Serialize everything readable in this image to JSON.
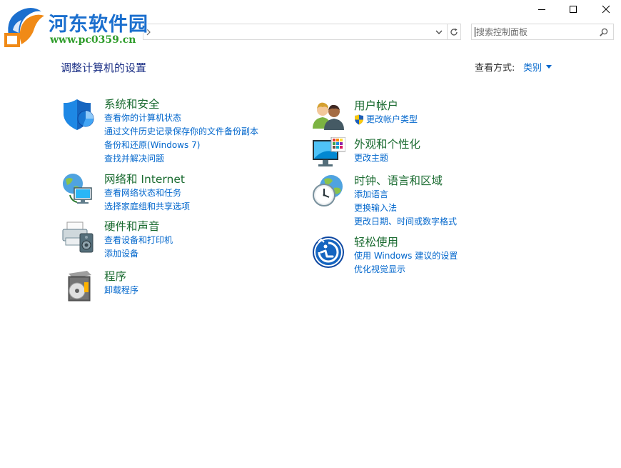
{
  "watermark": {
    "title": "河东软件园",
    "url": "www.pc0359.cn"
  },
  "address": {
    "path_text": ""
  },
  "search": {
    "placeholder": "搜索控制面板"
  },
  "header": {
    "title": "调整计算机的设置",
    "view_label": "查看方式:",
    "view_value": "类别"
  },
  "categories_left": [
    {
      "icon": "shield-security-icon",
      "title": "系统和安全",
      "links": [
        "查看你的计算机状态",
        "通过文件历史记录保存你的文件备份副本",
        "备份和还原(Windows 7)",
        "查找并解决问题"
      ]
    },
    {
      "icon": "network-globe-icon",
      "title": "网络和 Internet",
      "links": [
        "查看网络状态和任务",
        "选择家庭组和共享选项"
      ]
    },
    {
      "icon": "printer-speaker-icon",
      "title": "硬件和声音",
      "links": [
        "查看设备和打印机",
        "添加设备"
      ]
    },
    {
      "icon": "program-disc-icon",
      "title": "程序",
      "links": [
        "卸载程序"
      ]
    }
  ],
  "categories_right": [
    {
      "icon": "users-icon",
      "title": "用户帐户",
      "links": [
        "更改帐户类型"
      ]
    },
    {
      "icon": "monitor-palette-icon",
      "title": "外观和个性化",
      "links": [
        "更改主题"
      ]
    },
    {
      "icon": "clock-globe-icon",
      "title": "时钟、语言和区域",
      "links": [
        "添加语言",
        "更换输入法",
        "更改日期、时间或数字格式"
      ]
    },
    {
      "icon": "ease-of-access-icon",
      "title": "轻松使用",
      "links": [
        "使用 Windows 建议的设置",
        "优化视觉显示"
      ]
    }
  ],
  "colors": {
    "category_title": "#1a6b30",
    "link": "#0066cc",
    "page_title": "#1e3287"
  }
}
